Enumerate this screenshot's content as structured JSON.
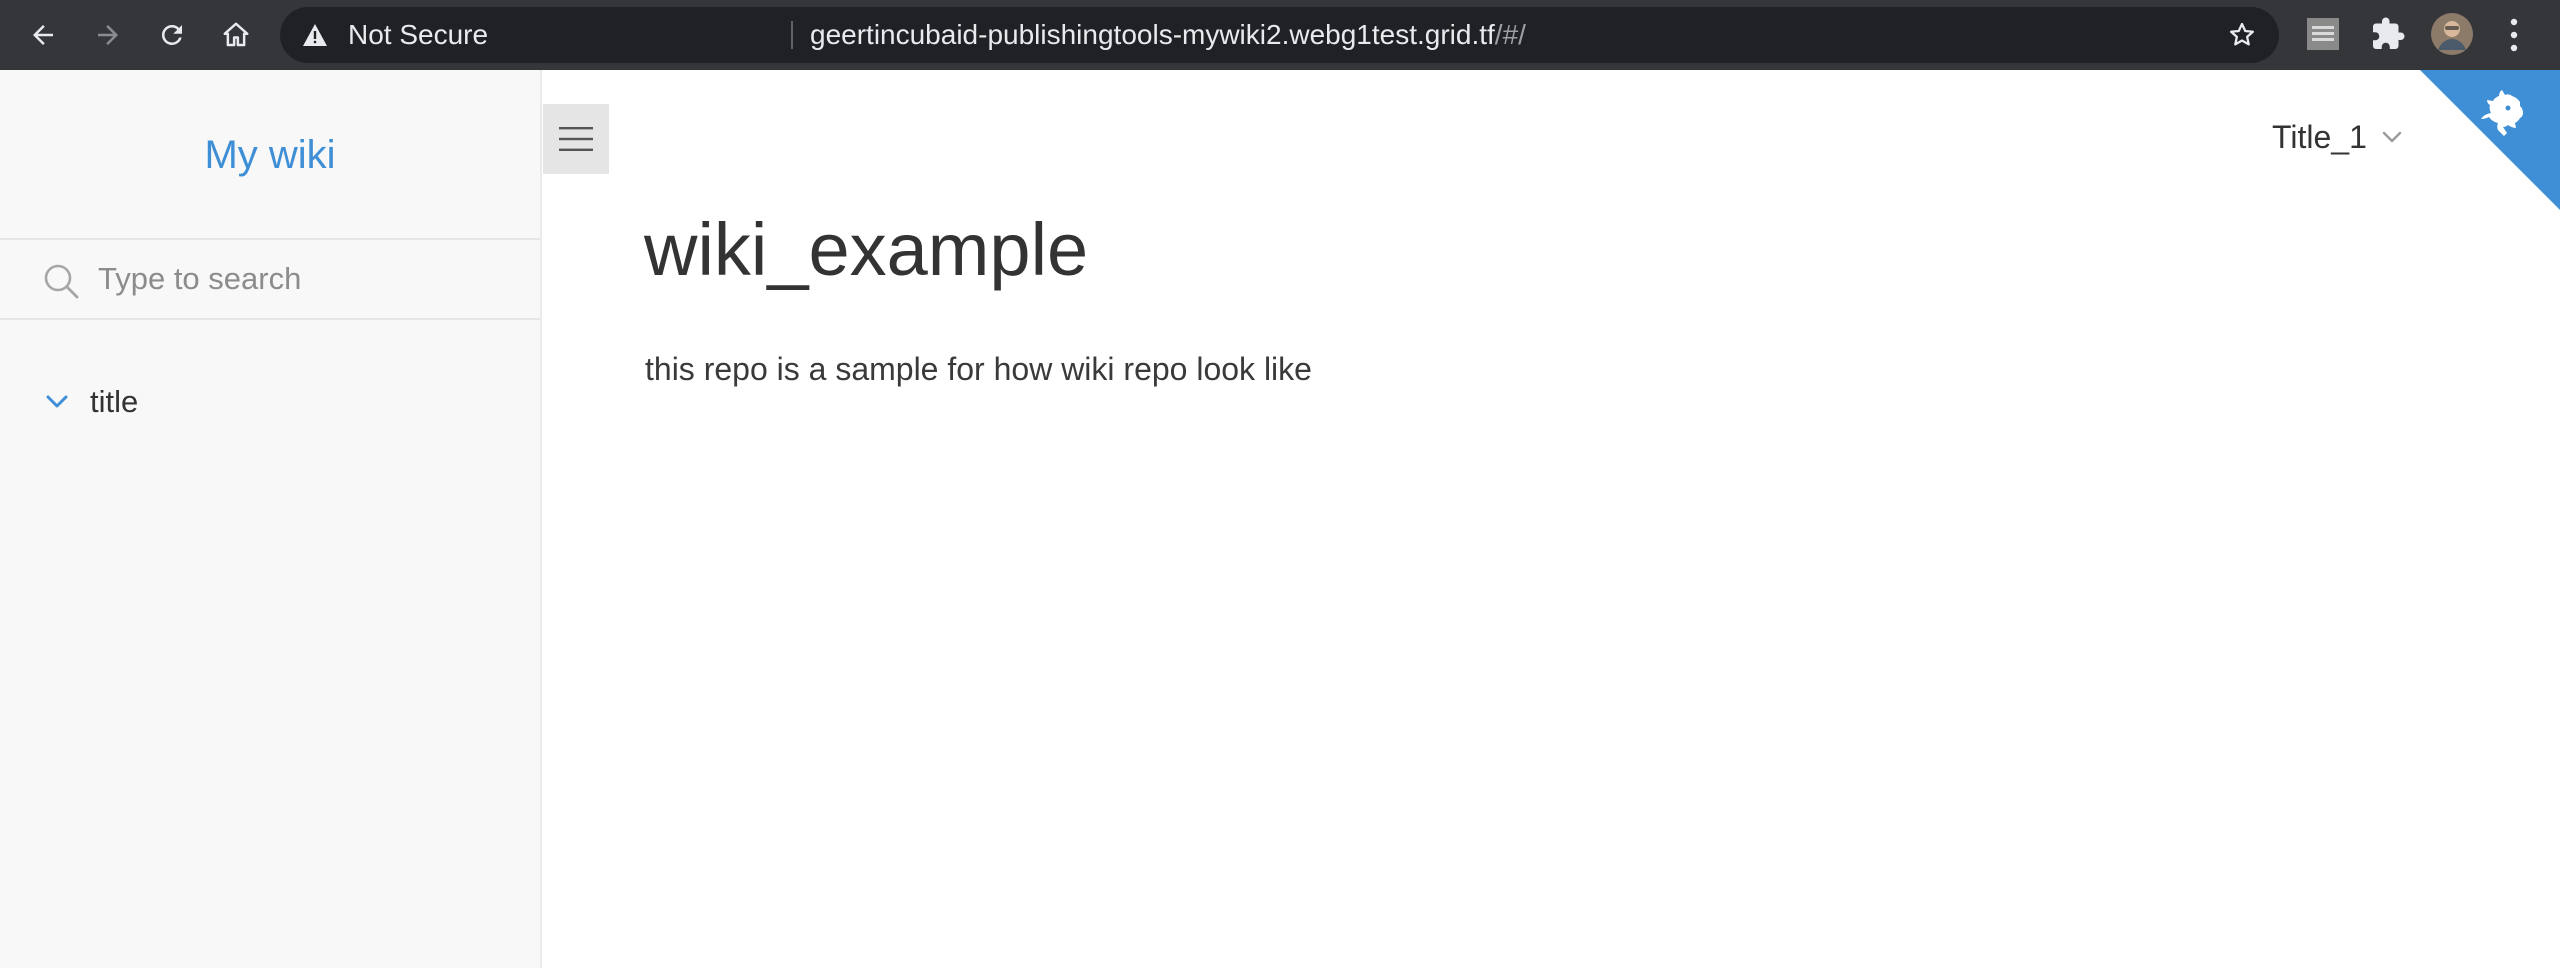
{
  "browser": {
    "security_label": "Not Secure",
    "url_host": "geertincubaid-publishingtools-mywiki2.webg1test.grid.tf",
    "url_path": "/#/"
  },
  "sidebar": {
    "app_name": "My wiki",
    "search_placeholder": "Type to search",
    "tree": [
      {
        "label": "title",
        "expanded": true
      }
    ]
  },
  "navbar": {
    "dropdown_label": "Title_1"
  },
  "content": {
    "title": "wiki_example",
    "paragraph": "this repo is a sample for how wiki repo look like"
  },
  "colors": {
    "accent": "#3f8fd6",
    "corner": "#3f8fd6",
    "toolbar": "#35363a",
    "omnibox": "#202124"
  }
}
